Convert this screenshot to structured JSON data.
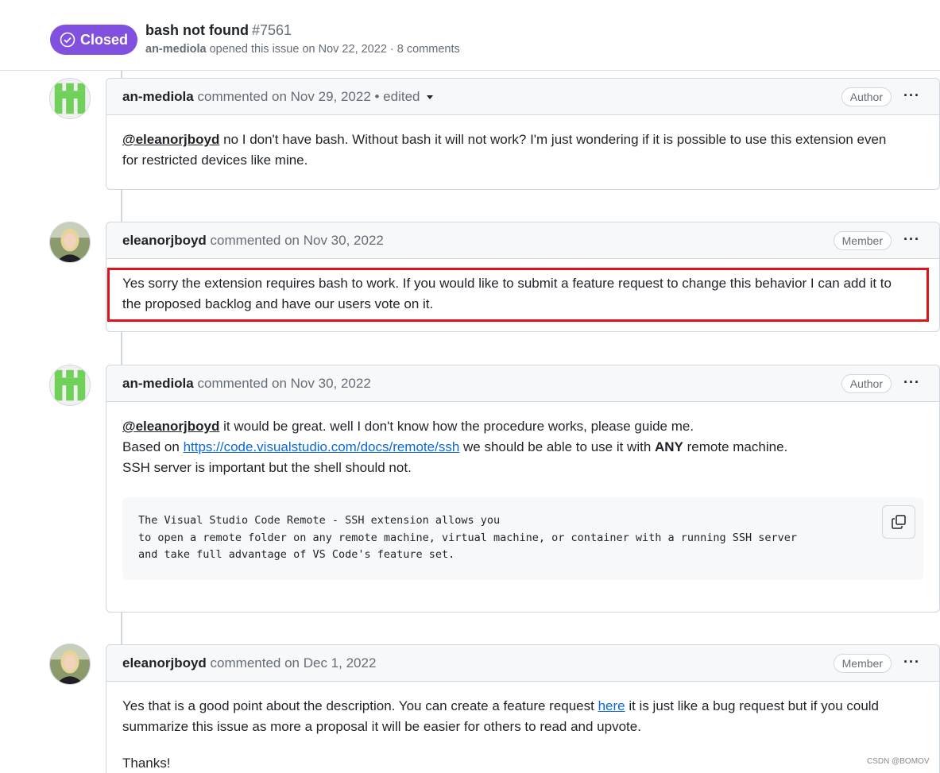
{
  "issue": {
    "state": "Closed",
    "title": "bash not found",
    "number": "#7561",
    "author": "an-mediola",
    "meta": "opened this issue on Nov 22, 2022 · 8 comments"
  },
  "comments": [
    {
      "author": "an-mediola",
      "meta": "commented on Nov 29, 2022 • edited",
      "role": "Author",
      "mention": "@eleanorjboyd",
      "text1": " no I don't have bash. Without bash it will not work? I'm just wondering if it is possible to use this extension even",
      "text2": "for restricted devices like mine."
    },
    {
      "author": "eleanorjboyd",
      "meta": "commented on Nov 30, 2022",
      "role": "Member",
      "text1": "Yes sorry the extension requires bash to work. If you would like to submit a feature request to change this behavior I can add it to",
      "text2": "the proposed backlog and have our users vote on it."
    },
    {
      "author": "an-mediola",
      "meta": "commented on Nov 30, 2022",
      "role": "Author",
      "mention": "@eleanorjboyd",
      "line1": " it would be great. well I don't know how the procedure works, please guide me.",
      "line2_pre": "Based on ",
      "line2_link": "https://code.visualstudio.com/docs/remote/ssh",
      "line2_mid": " we should be able to use it with ",
      "line2_bold": "ANY",
      "line2_post": " remote machine.",
      "line3": "SSH server is important but the shell should not.",
      "code": [
        "The Visual Studio Code Remote - SSH extension allows you",
        "to open a remote folder on any remote machine, virtual machine, or container with a running SSH server",
        "and take full advantage of VS Code's feature set."
      ]
    },
    {
      "author": "eleanorjboyd",
      "meta": "commented on Dec 1, 2022",
      "role": "Member",
      "line1_pre": "Yes that is a good point about the description. You can create a feature request ",
      "line1_link": "here",
      "line1_post": " it is just like a bug request but if you could",
      "line2": "summarize this issue as more a proposal it will be easier for others to read and upvote.",
      "line3": "Thanks!"
    }
  ],
  "watermark": "CSDN @BOMOV",
  "colors": {
    "closed_badge": "#8250df",
    "link": "#0969da",
    "highlight": "#e0121a"
  }
}
